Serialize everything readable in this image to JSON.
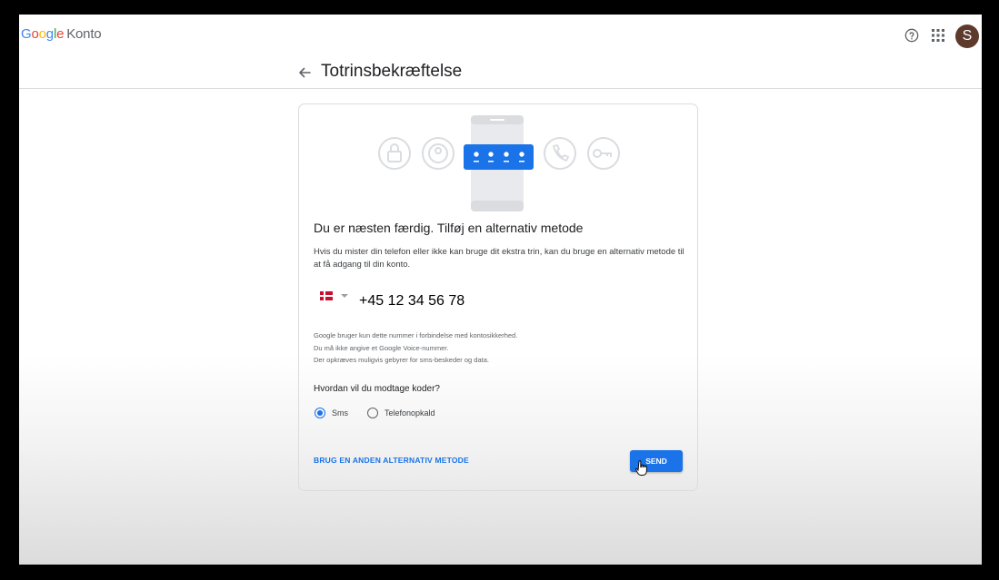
{
  "header": {
    "logo_letters": [
      "G",
      "o",
      "o",
      "g",
      "l",
      "e"
    ],
    "product_name": "Konto",
    "avatar_initial": "S",
    "icons": [
      "help-icon",
      "apps-grid-icon"
    ]
  },
  "page": {
    "title": "Totrinsbekræftelse",
    "back_icon": "arrow-left-icon"
  },
  "card": {
    "headline": "Du er næsten færdig. Tilføj en alternativ metode",
    "description": "Hvis du mister din telefon eller ikke kan bruge dit ekstra trin, kan du bruge en alternativ metode til at få adgang til din konto.",
    "phone": {
      "country_flag": "denmark-flag",
      "value": "+45 12 34 56 78"
    },
    "notes": [
      "Google bruger kun dette nummer i forbindelse med kontosikkerhed.",
      "Du må ikke angive et Google Voice-nummer.",
      "Der opkræves muligvis gebyrer for sms-beskeder og data."
    ],
    "question": "Hvordan vil du modtage koder?",
    "options": [
      {
        "label": "Sms",
        "selected": true
      },
      {
        "label": "Telefonopkald",
        "selected": false
      }
    ],
    "alt_method_link": "BRUG EN ANDEN ALTERNATIV METODE",
    "send_button": "SEND"
  },
  "colors": {
    "accent": "#1a73e8",
    "avatar_bg": "#5d3a2c"
  }
}
